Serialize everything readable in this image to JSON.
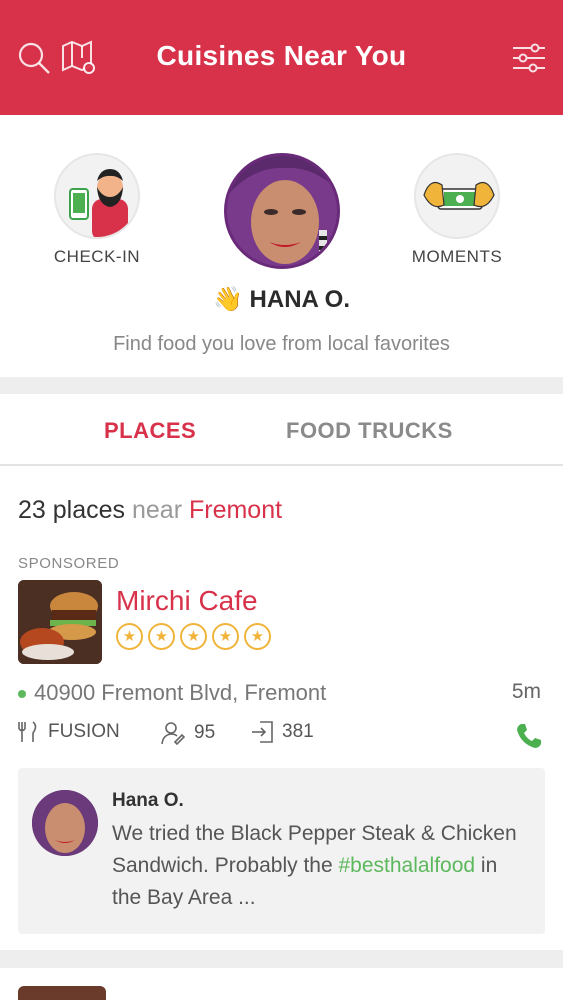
{
  "header": {
    "title": "Cuisines Near You",
    "bg_color": "#d8324b",
    "icons": [
      "search-icon",
      "map-icon",
      "filter-icon"
    ]
  },
  "profile": {
    "check_in_label": "CHECK-IN",
    "moments_label": "MOMENTS",
    "wave_emoji": "👋",
    "user_name": "HANA O.",
    "tagline": "Find food you love from local favorites"
  },
  "tabs": {
    "places": "PLACES",
    "food_trucks": "FOOD TRUCKS",
    "active": "places"
  },
  "results": {
    "count": "23 places",
    "near": "near",
    "city": "Fremont"
  },
  "listing": {
    "sponsored_label": "SPONSORED",
    "name": "Mirchi Cafe",
    "rating": 5,
    "address": "40900 Fremont Blvd, Fremont",
    "distance": "5m",
    "cuisine": "FUSION",
    "reviews_count": "95",
    "checkins_count": "381"
  },
  "review": {
    "author": "Hana O.",
    "text_before": "We tried the Black Pepper Steak  & Chicken Sandwich. Probably the ",
    "hashtag": "#besthalalfood",
    "text_after": " in the Bay Area ..."
  },
  "colors": {
    "accent": "#d8324b",
    "star": "#f0b43a",
    "open_dot": "#5cb85c",
    "phone": "#4caf50"
  }
}
